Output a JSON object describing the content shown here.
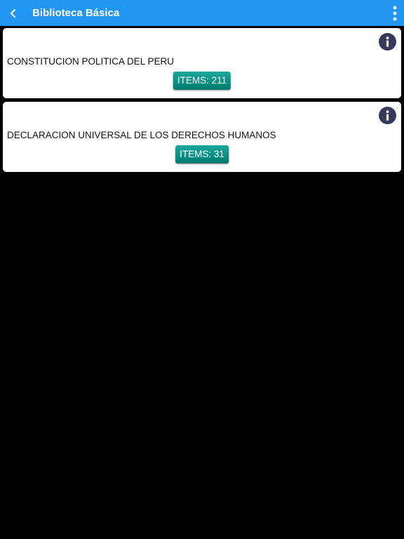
{
  "app_bar": {
    "title": "Biblioteca Básica",
    "back_icon": "chevron-left-icon",
    "menu_icon": "more-vertical-icon",
    "background": "#2196f3"
  },
  "cards": [
    {
      "title": "CONSTITUCION POLITICA DEL PERU",
      "items_label": "ITEMS",
      "items_count": "211",
      "info_icon": "info-icon"
    },
    {
      "title": "DECLARACION UNIVERSAL DE LOS DERECHOS HUMANOS",
      "items_label": "ITEMS",
      "items_count": "31",
      "info_icon": "info-icon"
    }
  ],
  "colors": {
    "info_button": "#36395a",
    "items_button": "#009688",
    "background": "#000000"
  }
}
